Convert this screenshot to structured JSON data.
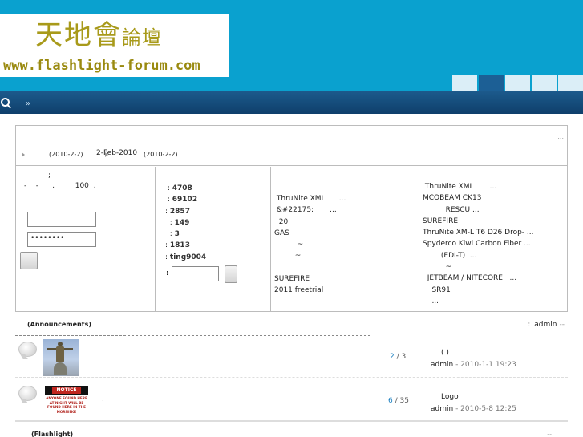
{
  "logo": {
    "cn_main": "天地會",
    "cn_small": "論壇",
    "url": "www.flashlight-forum.com"
  },
  "navbar": {
    "dot": "»"
  },
  "infobar": {
    "date1": "(2010-2-2)",
    "date2": "2-Feb-2010",
    "date3": "(2010-2-2)"
  },
  "login": {
    "line1": ";",
    "line2": "-    -      ,         100  ,",
    "password_value": "••••••••"
  },
  "stats": {
    "rows": [
      {
        "prefix": " : ",
        "value": "4708"
      },
      {
        "prefix": " : ",
        "value": "69102"
      },
      {
        "prefix": ": ",
        "value": "2857"
      },
      {
        "prefix": "  : ",
        "value": "149"
      },
      {
        "prefix": "  : ",
        "value": "3"
      },
      {
        "prefix": ": ",
        "value": "1813"
      },
      {
        "prefix": ": ",
        "value": "ting9004"
      }
    ],
    "quick_label": ":"
  },
  "latest": {
    "items": [
      " ThruNite XML      ...",
      " &#22175;       ...",
      "  20",
      "GAS",
      "          ~",
      "         ~",
      "",
      "SUREFIRE",
      "2011 freetrial"
    ]
  },
  "hot": {
    "items": [
      " ThruNite XML       ...",
      "MCOBEAM CK13",
      "          RESCU ...",
      "SUREFIRE",
      "ThruNite XM-L T6 D26 Drop- ...",
      "Spyderco Kiwi Carbon Fiber ...",
      "        (EDI-T)  ...",
      "          ~",
      "  JETBEAM / NITECORE   ...",
      "    SR91",
      "    ..."
    ]
  },
  "announcements": {
    "title": "(Announcements)",
    "colon": ":",
    "admin": "admin",
    "dash": "--"
  },
  "threads": [
    {
      "replies": "2",
      "views": "3",
      "last_title": "(  )",
      "last_by": "admin",
      "last_time": " - 2010-1-1 19:23"
    },
    {
      "desc": ":",
      "replies": "6",
      "views": "35",
      "last_title": "Logo",
      "last_by": "admin",
      "last_time": " - 2010-5-8 12:25"
    }
  ],
  "notice_img": {
    "header": "NOTICE",
    "text": "ANYONE FOUND HERE AT NIGHT WILL BE FOUND HERE IN THE MORNING!"
  },
  "section2": {
    "title": "(Flashlight)",
    "right": "--"
  }
}
